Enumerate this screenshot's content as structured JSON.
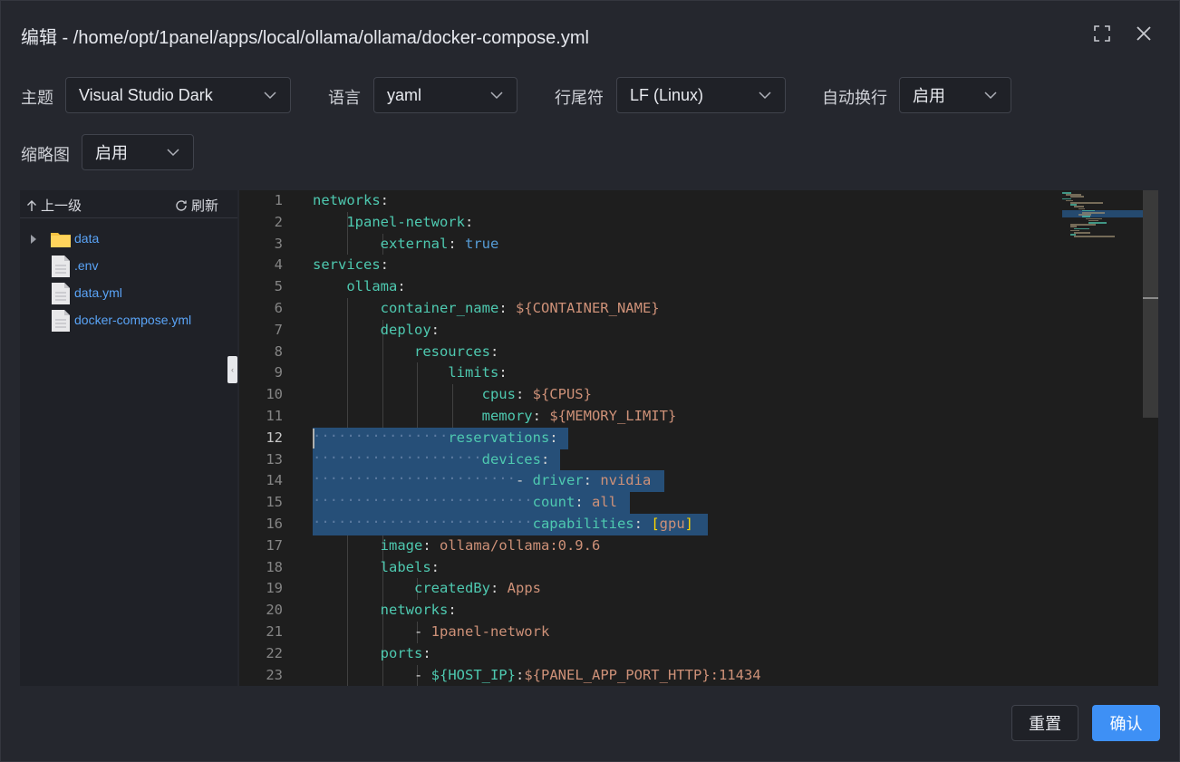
{
  "dialog": {
    "title": "编辑 - /home/opt/1panel/apps/local/ollama/ollama/docker-compose.yml"
  },
  "options": {
    "theme": {
      "label": "主题",
      "value": "Visual Studio Dark"
    },
    "language": {
      "label": "语言",
      "value": "yaml"
    },
    "eol": {
      "label": "行尾符",
      "value": "LF (Linux)"
    },
    "wordwrap": {
      "label": "自动换行",
      "value": "启用"
    },
    "minimap": {
      "label": "缩略图",
      "value": "启用"
    }
  },
  "tree": {
    "up_label": "上一级",
    "refresh_label": "刷新",
    "items": [
      {
        "name": "data",
        "type": "folder"
      },
      {
        "name": ".env",
        "type": "file"
      },
      {
        "name": "data.yml",
        "type": "file"
      },
      {
        "name": "docker-compose.yml",
        "type": "file"
      }
    ]
  },
  "editor": {
    "active_line": 12,
    "lines": [
      "networks:",
      "    1panel-network:",
      "        external: true",
      "services:",
      "    ollama:",
      "        container_name: ${CONTAINER_NAME}",
      "        deploy:",
      "            resources:",
      "                limits:",
      "                    cpus: ${CPUS}",
      "                    memory: ${MEMORY_LIMIT}",
      "                reservations:",
      "                    devices:",
      "                        - driver: nvidia",
      "                          count: all",
      "                          capabilities: [gpu]",
      "        image: ollama/ollama:0.9.6",
      "        labels:",
      "            createdBy: Apps",
      "        networks:",
      "            - 1panel-network",
      "        ports:",
      "            - ${HOST_IP}:${PANEL_APP_PORT_HTTP}:11434"
    ]
  },
  "footer": {
    "reset_label": "重置",
    "confirm_label": "确认"
  },
  "colors": {
    "accent": "#3e90f5",
    "selection": "#264f78",
    "key": "#4ec9b0",
    "string": "#ce9178",
    "bool": "#569cd6",
    "file_link": "#5aa4f7"
  }
}
